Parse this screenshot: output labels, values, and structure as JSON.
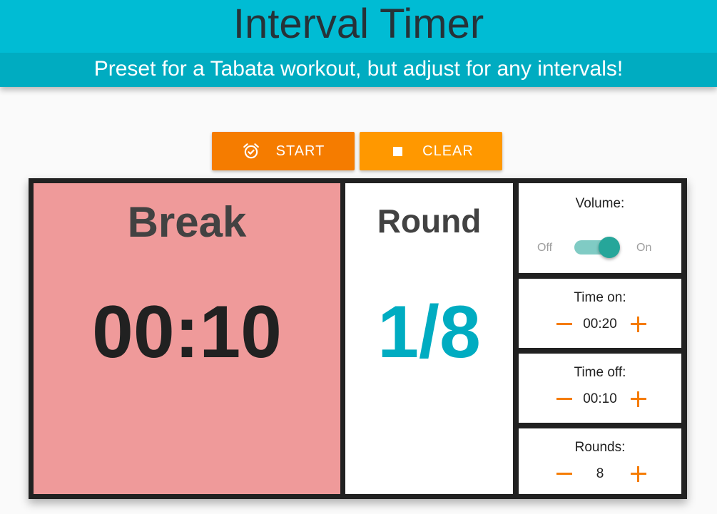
{
  "header": {
    "title": "Interval Timer",
    "subtitle": "Preset for a Tabata workout, but adjust for any intervals!"
  },
  "toolbar": {
    "start_label": "START",
    "start_icon": "alarm-clock-icon",
    "clear_label": "CLEAR",
    "clear_icon": "stop-square-icon"
  },
  "timer": {
    "phase": "Break",
    "time": "00:10"
  },
  "round": {
    "label": "Round",
    "value": "1/8"
  },
  "settings": {
    "volume": {
      "label": "Volume:",
      "off_label": "Off",
      "on_label": "On",
      "enabled": true
    },
    "time_on": {
      "label": "Time on:",
      "value": "00:20"
    },
    "time_off": {
      "label": "Time off:",
      "value": "00:10"
    },
    "rounds": {
      "label": "Rounds:",
      "value": "8"
    }
  },
  "colors": {
    "header": "#00bcd4",
    "subtitle_bar": "#00acc1",
    "start_button": "#f57c00",
    "clear_button": "#ff9800",
    "break_panel": "#ef9a9a",
    "round_value": "#00acc1",
    "stepper_accent": "#f57c00",
    "switch_accent": "#26a69a"
  }
}
